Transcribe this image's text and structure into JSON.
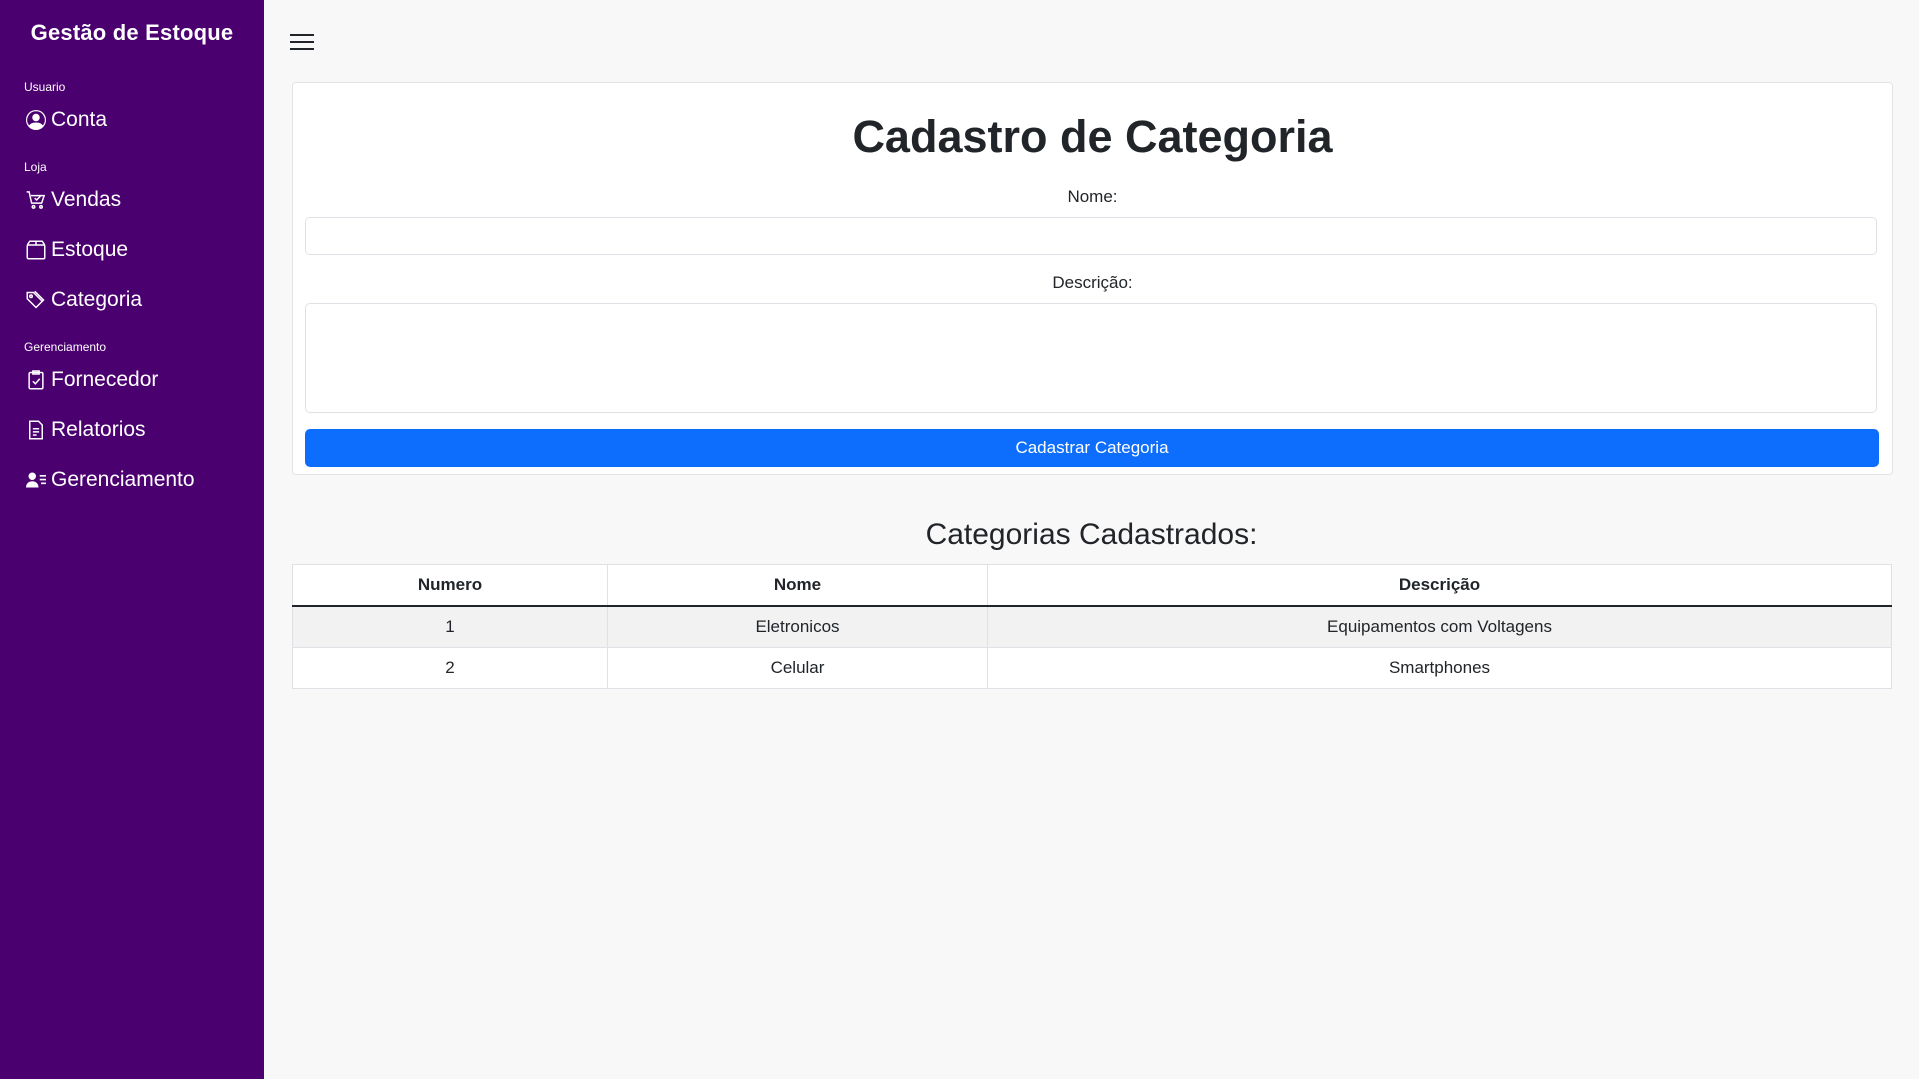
{
  "sidebar": {
    "brand": "Gestão de Estoque",
    "sections": [
      {
        "label": "Usuario",
        "items": [
          {
            "label": "Conta",
            "icon": "person-circle-icon"
          }
        ]
      },
      {
        "label": "Loja",
        "items": [
          {
            "label": "Vendas",
            "icon": "cart-icon"
          },
          {
            "label": "Estoque",
            "icon": "box-icon"
          },
          {
            "label": "Categoria",
            "icon": "tags-icon"
          }
        ]
      },
      {
        "label": "Gerenciamento",
        "items": [
          {
            "label": "Fornecedor",
            "icon": "clipboard-check-icon"
          },
          {
            "label": "Relatorios",
            "icon": "file-text-icon"
          },
          {
            "label": "Gerenciamento",
            "icon": "person-lines-icon"
          }
        ]
      }
    ]
  },
  "form": {
    "title": "Cadastro de Categoria",
    "name_label": "Nome:",
    "name_value": "",
    "description_label": "Descrição:",
    "description_value": "",
    "submit_label": "Cadastrar Categoria"
  },
  "list": {
    "title": "Categorias Cadastrados:",
    "columns": [
      "Numero",
      "Nome",
      "Descrição"
    ],
    "rows": [
      [
        "1",
        "Eletronicos",
        "Equipamentos com Voltagens"
      ],
      [
        "2",
        "Celular",
        "Smartphones"
      ]
    ]
  },
  "colors": {
    "sidebar_bg": "#4b0070",
    "primary": "#0d6efd",
    "page_bg": "#f8f8f8"
  }
}
